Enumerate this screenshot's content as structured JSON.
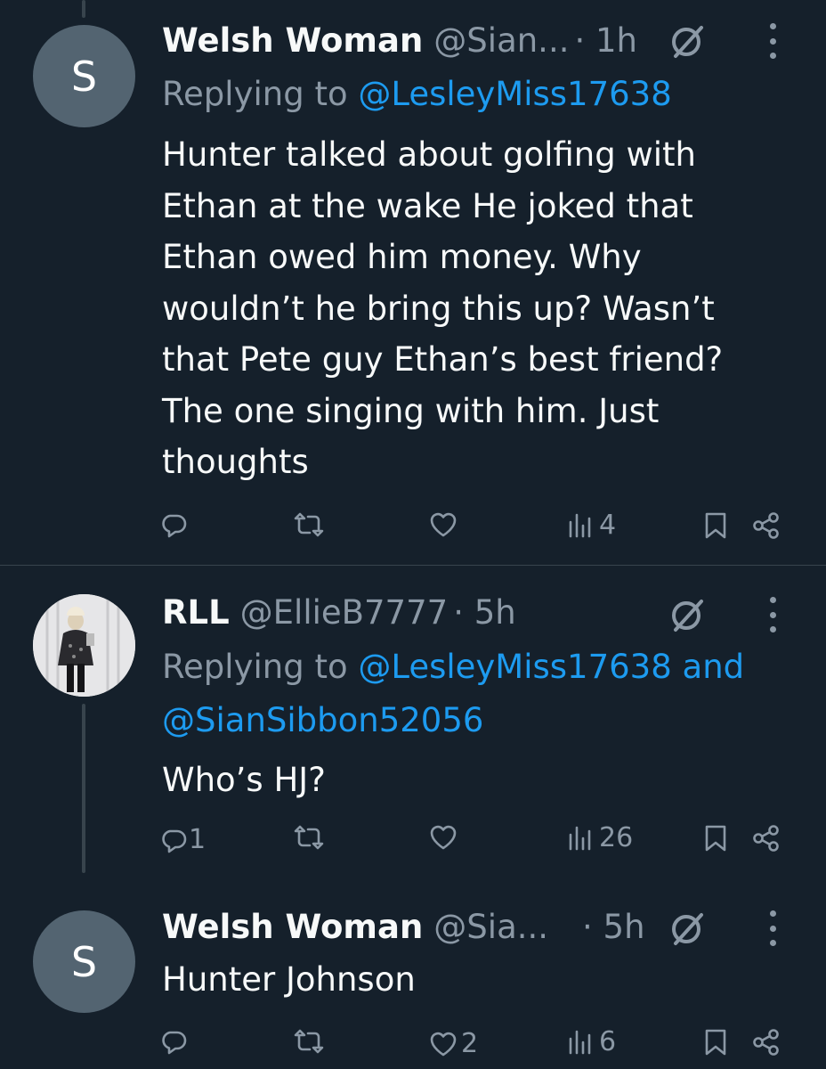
{
  "tweets": [
    {
      "display_name": "Welsh Woman",
      "handle": "@Sian...",
      "time": "· 1h",
      "avatar_letter": "S",
      "replying_prefix": "Replying to ",
      "replying_mentions": "@LesleyMiss17638",
      "body_lines": [
        "Hunter talked about golfing with",
        "Ethan at the wake  He joked that",
        "Ethan owed him money. Why",
        "wouldn’t he bring this up? Wasn’t",
        "that Pete guy Ethan’s best friend?",
        "The one singing with him. Just",
        "thoughts"
      ],
      "reply_count": "",
      "repost_count": "",
      "like_count": "",
      "views": "4"
    },
    {
      "display_name": "RLL",
      "handle": "@EllieB7777",
      "time": "· 5h",
      "avatar_image": "profile-photo",
      "replying_prefix": "Replying to ",
      "replying_mentions_line1": "@LesleyMiss17638 and",
      "replying_mentions_line2": "@SianSibbon52056",
      "body_lines": [
        "Who’s HJ?"
      ],
      "reply_count": "1",
      "repost_count": "",
      "like_count": "",
      "views": "26"
    },
    {
      "display_name": "Welsh Woman",
      "handle": "@Sia...",
      "time": "· 5h",
      "avatar_letter": "S",
      "body_lines": [
        "Hunter Johnson"
      ],
      "reply_count": "",
      "repost_count": "",
      "like_count": "2",
      "views": "6"
    }
  ],
  "colors": {
    "background": "#15202b",
    "text": "#f7f9f9",
    "secondary": "#8b98a5",
    "link": "#1d9bf0",
    "divider": "#38444d",
    "avatar": "#536471"
  },
  "icons": [
    "reply-icon",
    "repost-icon",
    "like-icon",
    "views-icon",
    "bookmark-icon",
    "share-icon",
    "grok-icon",
    "more-icon"
  ]
}
